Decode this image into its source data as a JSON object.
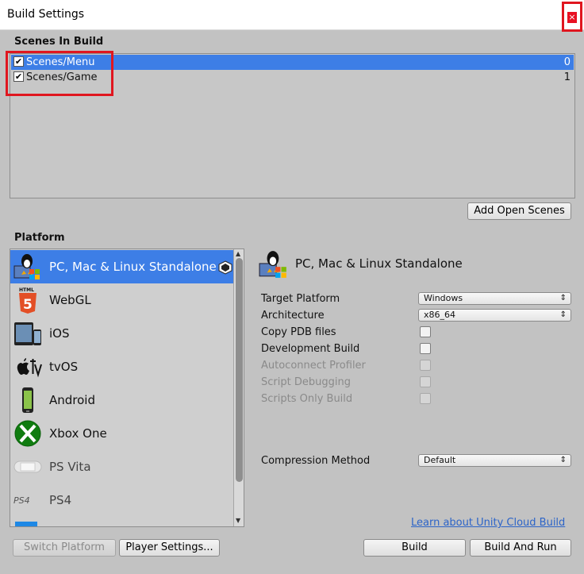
{
  "window": {
    "title": "Build Settings",
    "close_glyph": "×"
  },
  "scenes": {
    "title": "Scenes In Build",
    "items": [
      {
        "name": "Scenes/Menu",
        "index": "0",
        "checked": true,
        "selected": true
      },
      {
        "name": "Scenes/Game",
        "index": "1",
        "checked": true,
        "selected": false
      }
    ],
    "add_open_scenes_label": "Add Open Scenes"
  },
  "platform": {
    "title": "Platform",
    "items": [
      {
        "label": "PC, Mac & Linux Standalone",
        "icon": "tux-pc-icon",
        "selected": true
      },
      {
        "label": "WebGL",
        "icon": "html5-icon"
      },
      {
        "label": "iOS",
        "icon": "ios-devices-icon"
      },
      {
        "label": "tvOS",
        "icon": "apple-tv-icon"
      },
      {
        "label": "Android",
        "icon": "android-phone-icon"
      },
      {
        "label": "Xbox One",
        "icon": "xbox-icon"
      },
      {
        "label": "PS Vita",
        "icon": "ps-vita-icon",
        "dim": true
      },
      {
        "label": "PS4",
        "icon": "ps4-icon",
        "dim": true
      }
    ],
    "ps4_logo_text": "PS4"
  },
  "details": {
    "title": "PC, Mac & Linux Standalone",
    "target_platform": {
      "label": "Target Platform",
      "value": "Windows"
    },
    "architecture": {
      "label": "Architecture",
      "value": "x86_64"
    },
    "copy_pdb": {
      "label": "Copy PDB files",
      "checked": false
    },
    "development_build": {
      "label": "Development Build",
      "checked": false
    },
    "autoconnect_profiler": {
      "label": "Autoconnect Profiler",
      "disabled": true
    },
    "script_debugging": {
      "label": "Script Debugging",
      "disabled": true
    },
    "scripts_only_build": {
      "label": "Scripts Only Build",
      "disabled": true
    },
    "compression_method": {
      "label": "Compression Method",
      "value": "Default"
    }
  },
  "footer": {
    "cloud_link": "Learn about Unity Cloud Build",
    "switch_platform_label": "Switch Platform",
    "player_settings_label": "Player Settings...",
    "build_label": "Build",
    "build_and_run_label": "Build And Run"
  },
  "colors": {
    "selection": "#3d7ee6",
    "panel_bg": "#c2c2c2",
    "highlight_red": "#e0161f",
    "link_blue": "#2c64c8"
  }
}
